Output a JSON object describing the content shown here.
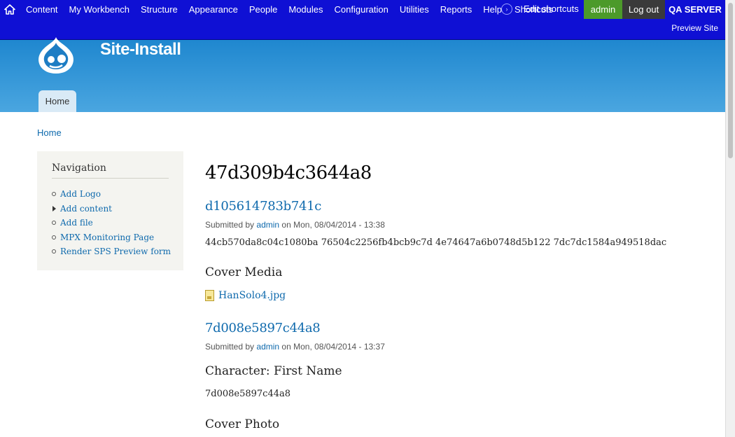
{
  "toolbar": {
    "menu": [
      "Content",
      "My Workbench",
      "Structure",
      "Appearance",
      "People",
      "Modules",
      "Configuration",
      "Utilities",
      "Reports",
      "Help"
    ],
    "shortcuts_label": "Shortcuts",
    "edit_shortcuts_label": "Edit shortcuts",
    "user_label": "admin",
    "logout_label": "Log out",
    "server_label": "QA SERVER",
    "preview_label": "Preview Site"
  },
  "header": {
    "site_name": "Site-Install",
    "home_tab": "Home"
  },
  "breadcrumb": "Home",
  "sidebar": {
    "title": "Navigation",
    "items": [
      {
        "label": "Add Logo",
        "marker": "circle"
      },
      {
        "label": "Add content",
        "marker": "triangle"
      },
      {
        "label": "Add file",
        "marker": "circle"
      },
      {
        "label": "MPX Monitoring Page",
        "marker": "circle"
      },
      {
        "label": "Render SPS Preview form",
        "marker": "circle"
      }
    ]
  },
  "main": {
    "page_title": "47d309b4c3644a8",
    "node1": {
      "title": "d105614783b741c",
      "submitted_prefix": "Submitted by",
      "submitted_user": "admin",
      "submitted_date": "on Mon, 08/04/2014 - 13:38",
      "body": "44cb570da8c04c1080ba 76504c2256fb4bcb9c7d 4e74647a6b0748d5b122 7dc7dc1584a949518dac",
      "field_label": "Cover Media",
      "file_name": "HanSolo4.jpg"
    },
    "node2": {
      "title": "7d008e5897c44a8",
      "submitted_prefix": "Submitted by",
      "submitted_user": "admin",
      "submitted_date": "on Mon, 08/04/2014 - 13:37",
      "field1_label": "Character: First Name",
      "field1_value": "7d008e5897c44a8",
      "field2_label": "Cover Photo"
    }
  },
  "colors": {
    "toolbar_bg": "#0f10d4",
    "header_gradient_top": "#1f87cf",
    "header_gradient_bottom": "#4aa6e0",
    "link": "#0f6aad",
    "admin_badge": "#4c9a2a",
    "logout_bg": "#3a3a3a"
  }
}
